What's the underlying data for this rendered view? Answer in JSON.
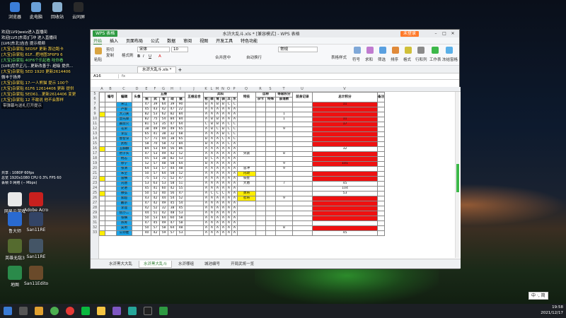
{
  "desktop": {
    "icons_top": [
      {
        "label": "浏览器",
        "color": "#3b7dd8"
      },
      {
        "label": "此电脑",
        "color": "#6aa0d8"
      },
      {
        "label": "回收站",
        "color": "#8ab0d0"
      },
      {
        "label": "云同屏",
        "color": "#2a2a2a"
      }
    ],
    "icons_left": [
      {
        "label": "网易云游戏",
        "color": "#e8e8e8"
      },
      {
        "label": "Adobe Acrobat",
        "color": "#c8201e"
      },
      {
        "label": "鲁大师",
        "color": "#2a6ad0"
      },
      {
        "label": "San11RE",
        "color": "#334466"
      },
      {
        "label": "英雄无敌3",
        "color": "#556b2f"
      },
      {
        "label": "San11RE",
        "color": "#445566"
      },
      {
        "label": "地图",
        "color": "#2a8a4a"
      },
      {
        "label": "San11Editor",
        "color": "#6a4a2a"
      }
    ]
  },
  "chat": {
    "lines": [
      {
        "text": "欢迎[LV9]weiz进入直播间",
        "cls": ""
      },
      {
        "text": "欢迎[LV5]东南]门冲 进入直播间",
        "cls": ""
      },
      {
        "text": "[LV6]东北]吉吉 提示视频",
        "cls": ""
      },
      {
        "text": "[大宝]杂家贴 5ED5F 更新 那边跑卡",
        "cls": "hl"
      },
      {
        "text": "[大宝]杂家贴 61F...把地图3F6F9 6",
        "cls": "hl"
      },
      {
        "text": "[大宝]杂家贴 40F6个乐起看 哇你看",
        "cls": "gn"
      },
      {
        "text": "[LV8]尼乔正儿...更新改善于: 超级 提供...",
        "cls": ""
      },
      {
        "text": "[大宝]杂家贴 5ED 1920 更新2614406",
        "cls": "hl"
      },
      {
        "text": "微丰于扬斧",
        "cls": ""
      },
      {
        "text": "[大宝]杂家贴 17-一人熊猫 提示 100个",
        "cls": "hl"
      },
      {
        "text": "[大宝]杂家贴 61F6 12614406 更新 提供",
        "cls": "hl"
      },
      {
        "text": "[大宝]杂家贴 5ED61...更新2614406 变更",
        "cls": "hl"
      },
      {
        "text": "[大宝]杂家贴 12 不敢说 他不会那样",
        "cls": "hl"
      }
    ],
    "tip": "带弹幕与送礼打开提示"
  },
  "stream_info": [
    "共享 : 1080P 60fps",
    "总览 1920x1080 CPU 0.3%   FPS 60",
    "丢帧 0  网络 (-- Mbps)"
  ],
  "window": {
    "app_button": "WPS 表格",
    "doc_title": "水浒大乱斗.xls * [兼容模式] - WPS 表格",
    "login_button": "未登录",
    "menu": [
      "开始",
      "插入",
      "页面布局",
      "公式",
      "数据",
      "审阅",
      "视图",
      "开发工具",
      "特色功能"
    ],
    "ribbon": {
      "paste": "粘贴",
      "cut": "剪切",
      "copy": "复制",
      "format_painter": "格式刷",
      "font_name": "宋体",
      "font_size": "10",
      "merge": "合并居中",
      "wrap": "自动换行",
      "number_format": "常规",
      "table_style": "表格样式",
      "symbol": "符号",
      "sum": "求和",
      "filter": "筛选",
      "sort": "排序",
      "format": "格式",
      "rowcol": "行和列",
      "worksheet": "工作表",
      "freeze": "冻结窗格"
    },
    "doc_tab": "水浒大乱斗.xls *",
    "cell_ref": "A16",
    "fx": "fx",
    "sheets": [
      "水浒黑大大乱",
      "水浒黑大乱斗",
      "水浒哪组",
      "城池编号",
      "开局武将一览"
    ],
    "current_sheet_index": 1
  },
  "sheet": {
    "col_letters": [
      "A",
      "B",
      "C",
      "D",
      "E",
      "F",
      "G",
      "H",
      "I",
      "J",
      "K",
      "L",
      "M",
      "N",
      "O",
      "P",
      "Q",
      "R",
      "S",
      "T",
      "U",
      "V"
    ],
    "header1": {
      "no": "编号",
      "name": "编辑",
      "id": "头像",
      "stats": "五维",
      "five_sum": "五维总合",
      "troops": "兵科",
      "special": "特技",
      "self_title": "自称",
      "talent": "等级积分",
      "record": "前身记录",
      "score": "总计积分",
      "note": "备注"
    },
    "header2": {
      "stat_labels": [
        "统",
        "武",
        "智",
        "政",
        "魅"
      ],
      "troop_labels": [
        "枪",
        "戟",
        "弩",
        "骑",
        "兵",
        "水"
      ],
      "self_labels": [
        "杂卡",
        "特殊"
      ],
      "talent_labels": [
        "部落数",
        "特技数"
      ]
    },
    "row_start": 5,
    "rows": [
      {
        "name": "",
        "s": [
          "",
          "",
          "",
          "",
          ""
        ],
        "t": [
          "",
          "",
          "",
          "",
          "",
          ""
        ],
        "special": "",
        "score": "",
        "yellow_a": false,
        "red": false
      },
      {
        "name": "",
        "s": [
          "",
          "",
          "",
          "",
          ""
        ],
        "t": [
          "",
          "",
          "",
          "",
          "",
          ""
        ],
        "special": "",
        "score": "",
        "yellow_a": false,
        "red": false
      },
      {
        "name": "宋江",
        "s": [
          "47",
          "39",
          "64",
          "39",
          "90"
        ],
        "t": [
          "B",
          "A",
          "B",
          "B",
          "C",
          "C"
        ],
        "special": "",
        "score": "11",
        "yellow_a": false,
        "red": true
      },
      {
        "name": "卢俊",
        "s": [
          "45",
          "43",
          "42",
          "47",
          "22"
        ],
        "t": [
          "A",
          "A",
          "A",
          "A",
          "A",
          "A"
        ],
        "special": "",
        "score": "",
        "yellow_a": false,
        "red": true
      },
      {
        "name": "大刀关",
        "s": [
          "82",
          "53",
          "62",
          "82",
          "84"
        ],
        "t": [
          "A",
          "A",
          "A",
          "A",
          "A",
          "A"
        ],
        "special": "",
        "score": "",
        "yellow_a": true,
        "red": true
      },
      {
        "name": "急先锋",
        "s": [
          "82",
          "75",
          "54",
          "84",
          "84"
        ],
        "t": [
          "A",
          "B",
          "B",
          "A",
          "A",
          "A"
        ],
        "special": "",
        "score": "11",
        "yellow_a": false,
        "red": true
      },
      {
        "name": "霹雳火",
        "s": [
          "81",
          "53",
          "35",
          "47",
          "64"
        ],
        "t": [
          "C",
          "B",
          "B",
          "A",
          "C",
          "C"
        ],
        "special": "",
        "score": "17",
        "yellow_a": false,
        "red": true
      },
      {
        "name": "花荣",
        "s": [
          "38",
          "49",
          "49",
          "49",
          "65"
        ],
        "t": [
          "A",
          "B",
          "C",
          "B",
          "C",
          "C"
        ],
        "special": "",
        "score": "",
        "yellow_a": false,
        "red": true
      },
      {
        "name": "李应",
        "s": [
          "65",
          "41",
          "38",
          "32",
          "68"
        ],
        "t": [
          "A",
          "A",
          "A",
          "B",
          "C",
          "C"
        ],
        "special": "",
        "score": "",
        "yellow_a": false,
        "red": true
      },
      {
        "name": "鲁智深",
        "s": [
          "57",
          "71",
          "44",
          "38",
          "65"
        ],
        "t": [
          "B",
          "A",
          "A",
          "C",
          "A",
          "C"
        ],
        "special": "",
        "score": "",
        "yellow_a": false,
        "red": true
      },
      {
        "name": "武松",
        "s": [
          "58",
          "70",
          "58",
          "72",
          "84"
        ],
        "t": [
          "B",
          "A",
          "A",
          "A",
          "C",
          "A"
        ],
        "special": "",
        "score": "",
        "yellow_a": false,
        "red": true
      },
      {
        "name": "玉麒麟",
        "s": [
          "84",
          "53",
          "69",
          "56",
          "86"
        ],
        "t": [
          "A",
          "A",
          "A",
          "A",
          "A",
          "A"
        ],
        "special": "",
        "score": "32",
        "yellow_a": true,
        "red": false
      },
      {
        "name": "豹子头",
        "s": [
          "47",
          "53",
          "49",
          "42",
          "52"
        ],
        "t": [
          "A",
          "A",
          "A",
          "A",
          "A",
          "A"
        ],
        "special": "突袭",
        "score": "",
        "yellow_a": false,
        "red": true
      },
      {
        "name": "杨志",
        "s": [
          "45",
          "53",
          "38",
          "82",
          "53"
        ],
        "t": [
          "B",
          "C",
          "A",
          "A",
          "A",
          "A"
        ],
        "special": "",
        "score": "",
        "yellow_a": false,
        "red": true
      },
      {
        "name": "徐宁",
        "s": [
          "52",
          "57",
          "48",
          "58",
          "64"
        ],
        "t": [
          "B",
          "A",
          "A",
          "A",
          "A",
          "A"
        ],
        "special": "",
        "score": "101",
        "yellow_a": false,
        "red": true
      },
      {
        "name": "张清",
        "s": [
          "64",
          "53",
          "57",
          "44",
          "48"
        ],
        "t": [
          "A",
          "A",
          "A",
          "A",
          "A",
          "A"
        ],
        "special": "冒冲",
        "score": "",
        "yellow_a": false,
        "red": false
      },
      {
        "name": "朱仝",
        "s": [
          "50",
          "57",
          "64",
          "58",
          "52"
        ],
        "t": [
          "A",
          "A",
          "A",
          "A",
          "A",
          "A"
        ],
        "special": "内政",
        "score": "",
        "yellow_a": false,
        "red": true
      },
      {
        "name": "雷横",
        "s": [
          "75",
          "53",
          "71",
          "52",
          "47"
        ],
        "t": [
          "A",
          "A",
          "A",
          "A",
          "A",
          "A"
        ],
        "special": "铁壁",
        "score": "",
        "yellow_a": true,
        "red": true
      },
      {
        "name": "刘唐",
        "s": [
          "53",
          "63",
          "53",
          "58",
          "51"
        ],
        "t": [
          "A",
          "A",
          "A",
          "A",
          "A",
          "A"
        ],
        "special": "大盾",
        "score": "45",
        "yellow_a": false,
        "red": false
      },
      {
        "name": "史进",
        "s": [
          "45",
          "41",
          "60",
          "42",
          "55"
        ],
        "t": [
          "A",
          "A",
          "A",
          "A",
          "A",
          "A"
        ],
        "special": "",
        "score": "104",
        "yellow_a": false,
        "red": false
      },
      {
        "name": "穆弘",
        "s": [
          "50",
          "52",
          "40",
          "56",
          "47"
        ],
        "t": [
          "A",
          "C",
          "C",
          "C",
          "A",
          "A"
        ],
        "special": "勇将",
        "score": "53",
        "yellow_a": true,
        "red": false
      },
      {
        "name": "索超",
        "s": [
          "43",
          "42",
          "44",
          "54",
          "52"
        ],
        "t": [
          "A",
          "A",
          "A",
          "A",
          "A",
          "A"
        ],
        "special": "智将",
        "score": "",
        "yellow_a": false,
        "red": true
      },
      {
        "name": "戴宗",
        "s": [
          "47",
          "42",
          "49",
          "45",
          "54"
        ],
        "t": [
          "A",
          "A",
          "A",
          "A",
          "A",
          "A"
        ],
        "special": "",
        "score": "",
        "yellow_a": false,
        "red": true
      },
      {
        "name": "李逵",
        "s": [
          "42",
          "52",
          "32",
          "38",
          "45"
        ],
        "t": [
          "A",
          "A",
          "A",
          "A",
          "A",
          "A"
        ],
        "special": "",
        "score": "",
        "yellow_a": false,
        "red": true
      },
      {
        "name": "阮小二",
        "s": [
          "44",
          "51",
          "42",
          "48",
          "53"
        ],
        "t": [
          "A",
          "A",
          "A",
          "A",
          "A",
          "A"
        ],
        "special": "",
        "score": "",
        "yellow_a": false,
        "red": true
      },
      {
        "name": "张横",
        "s": [
          "50",
          "53",
          "64",
          "60",
          "58"
        ],
        "t": [
          "A",
          "A",
          "A",
          "A",
          "A",
          "A"
        ],
        "special": "",
        "score": "",
        "yellow_a": false,
        "red": true
      },
      {
        "name": "燕青",
        "s": [
          "47",
          "45",
          "49",
          "47",
          "58"
        ],
        "t": [
          "A",
          "A",
          "A",
          "A",
          "A",
          "A"
        ],
        "special": "",
        "score": "",
        "yellow_a": false,
        "red": false
      },
      {
        "name": "吴用",
        "s": [
          "50",
          "57",
          "58",
          "64",
          "48"
        ],
        "t": [
          "A",
          "A",
          "A",
          "A",
          "A",
          "A"
        ],
        "special": "",
        "score": "",
        "yellow_a": false,
        "red": true
      },
      {
        "name": "公孙胜",
        "s": [
          "40",
          "42",
          "59",
          "57",
          "53"
        ],
        "t": [
          "A",
          "A",
          "A",
          "A",
          "A",
          "A"
        ],
        "special": "",
        "score": "45",
        "yellow_a": true,
        "red": false
      }
    ],
    "extra_nums": [
      {
        "row": 9,
        "text": "1"
      },
      {
        "row": 10,
        "text": "1"
      },
      {
        "row": 12,
        "text": "9"
      },
      {
        "row": 17,
        "text": "8"
      },
      {
        "row": 19,
        "text": "9"
      },
      {
        "row": 20,
        "text": "9"
      },
      {
        "row": 23,
        "text": "7"
      },
      {
        "row": 26,
        "text": "9"
      },
      {
        "row": 32,
        "text": "8"
      }
    ]
  },
  "taskbar": {
    "time": "19:58",
    "date": "2021/12/17",
    "ime": "中 ·, 简"
  },
  "colors": {
    "blue_col": "#1aa3e8",
    "yellow": "#ffee00",
    "red": "#ee1111",
    "wps_green": "#2e9a42"
  }
}
